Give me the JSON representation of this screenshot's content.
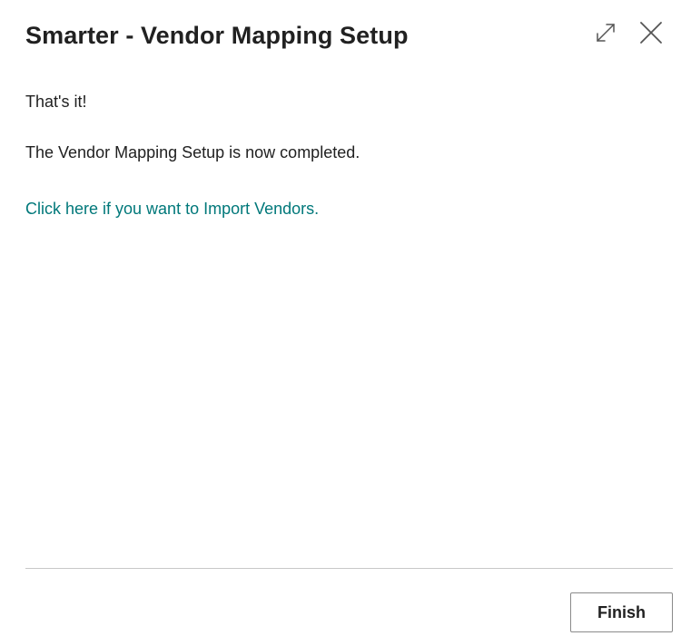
{
  "dialog": {
    "title": "Smarter - Vendor Mapping Setup",
    "header_icons": {
      "expand": "expand-icon",
      "close": "close-icon"
    }
  },
  "content": {
    "line1": "That's it!",
    "line2": "The Vendor Mapping Setup is now completed.",
    "link_text": "Click here if you want to Import Vendors."
  },
  "footer": {
    "finish_label": "Finish"
  },
  "colors": {
    "link": "#00787a",
    "text": "#212121",
    "divider": "#c8c8c8",
    "button_border": "#8a8a8a"
  }
}
